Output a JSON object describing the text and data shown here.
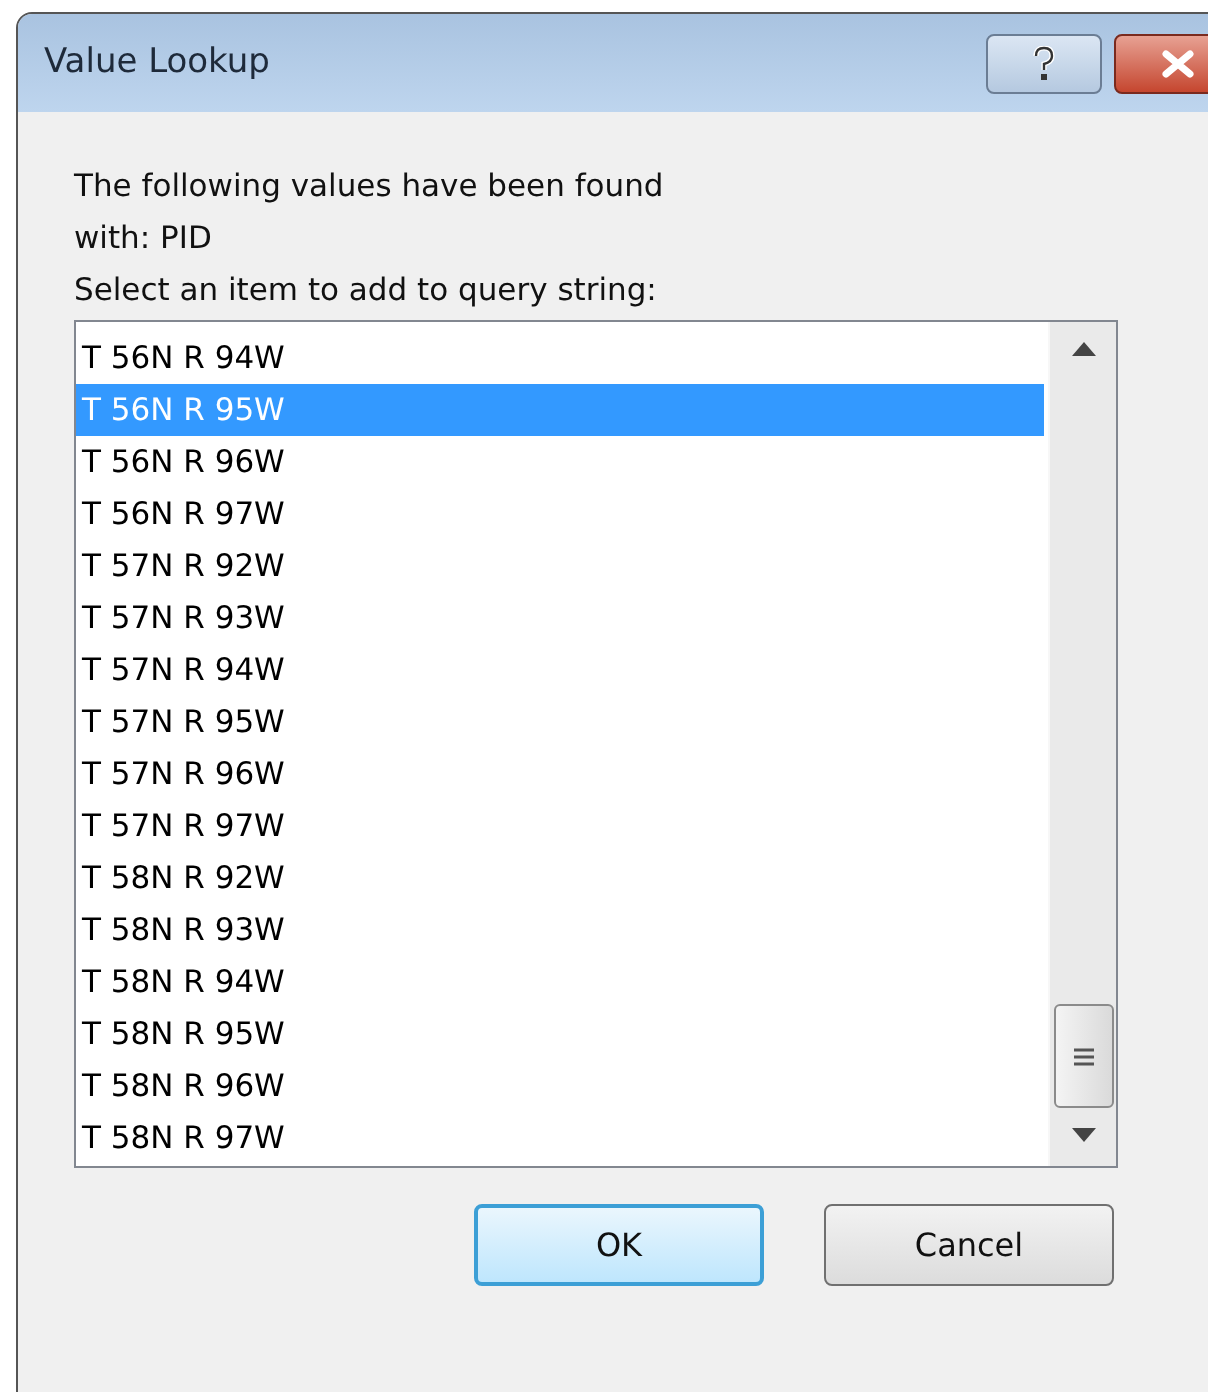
{
  "window": {
    "title": "Value Lookup"
  },
  "message": [
    "The following values have been found",
    "with: PID",
    "Select an item to add to query string:"
  ],
  "items": [
    {
      "label": "T 56N R 94W",
      "selected": false
    },
    {
      "label": "T 56N R 95W",
      "selected": true
    },
    {
      "label": "T 56N R 96W",
      "selected": false
    },
    {
      "label": "T 56N R 97W",
      "selected": false
    },
    {
      "label": "T 57N R 92W",
      "selected": false
    },
    {
      "label": "T 57N R 93W",
      "selected": false
    },
    {
      "label": "T 57N R 94W",
      "selected": false
    },
    {
      "label": "T 57N R 95W",
      "selected": false
    },
    {
      "label": "T 57N R 96W",
      "selected": false
    },
    {
      "label": "T 57N R 97W",
      "selected": false
    },
    {
      "label": "T 58N R 92W",
      "selected": false
    },
    {
      "label": "T 58N R 93W",
      "selected": false
    },
    {
      "label": "T 58N R 94W",
      "selected": false
    },
    {
      "label": "T 58N R 95W",
      "selected": false
    },
    {
      "label": "T 58N R 96W",
      "selected": false
    },
    {
      "label": "T 58N R 97W",
      "selected": false
    }
  ],
  "buttons": [
    {
      "label": "OK",
      "kind": "default"
    },
    {
      "label": "Cancel",
      "kind": "normal"
    }
  ]
}
